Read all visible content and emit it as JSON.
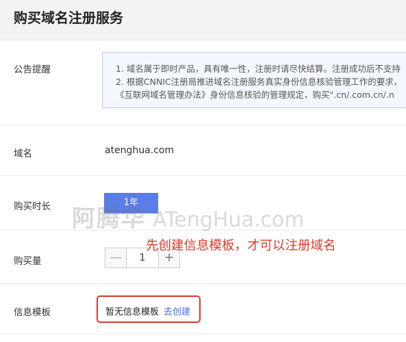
{
  "page": {
    "title": "购买域名注册服务"
  },
  "notice": {
    "label": "公告提醒",
    "line1": "1. 域名属于即时产品，具有唯一性，注册时请尽快结算。注册成功后不支持",
    "line2": "2. 根据CNNIC注册局推进域名注册服务真实身份信息核验管理工作的要求，",
    "line3": "《互联网域名管理办法》身份信息核验的管理规定，购买\".cn/.com.cn/.n"
  },
  "domain": {
    "label": "域名",
    "value": "atenghua.com"
  },
  "duration": {
    "label": "购买时长",
    "selected": "1年"
  },
  "quantity": {
    "label": "购买量",
    "value": "1",
    "minus": "—",
    "plus": "+"
  },
  "template": {
    "label": "信息模板",
    "empty_text": "暂无信息模板",
    "create_link": "去创建"
  },
  "annotation": {
    "text": "先创建信息模板，才可以注册域名"
  },
  "watermark": {
    "cn": "阿腾华",
    "en": "ATengHua.com"
  },
  "colors": {
    "accent": "#5a7de6",
    "link": "#3d6fe6",
    "annotation": "#e0392b",
    "notice_bg": "#f4f7ff"
  }
}
